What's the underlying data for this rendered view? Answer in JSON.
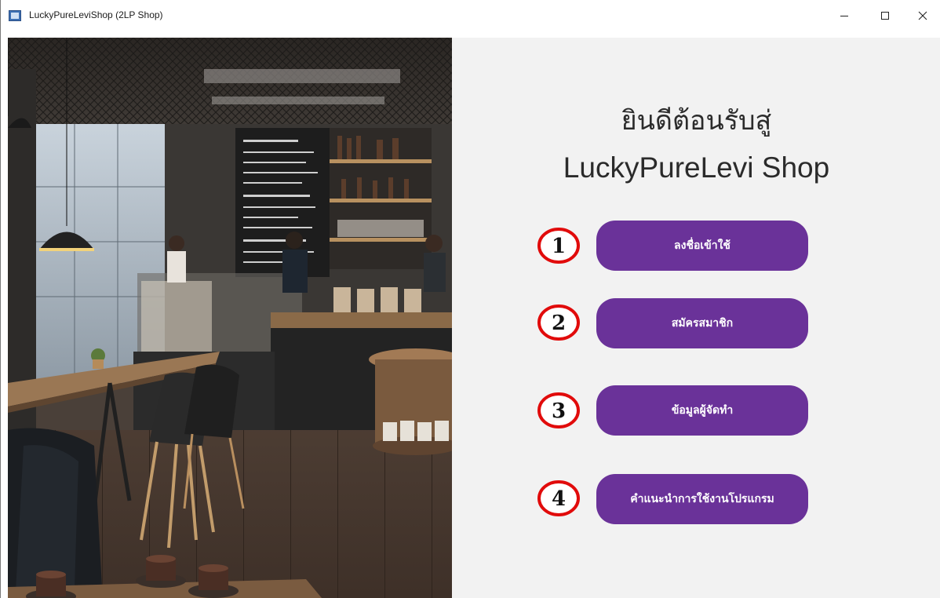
{
  "window": {
    "title": "LuckyPureLeviShop (2LP Shop)",
    "minimize_glyph": "—",
    "maximize_glyph": "☐",
    "close_glyph": "✕"
  },
  "welcome": {
    "line1": "ยินดีต้อนรับสู่",
    "line2": "LuckyPureLevi Shop"
  },
  "menu": [
    {
      "number": "1",
      "label": "ลงชื่อเข้าใช้"
    },
    {
      "number": "2",
      "label": "สมัครสมาชิก"
    },
    {
      "number": "3",
      "label": "ข้อมูลผู้จัดทำ"
    },
    {
      "number": "4",
      "label": "คำแนะนำการใช้งานโปรแกรม"
    }
  ],
  "colors": {
    "button_bg": "#6a3299",
    "badge_ring": "#e10b0b",
    "panel_bg": "#f2f2f2"
  }
}
